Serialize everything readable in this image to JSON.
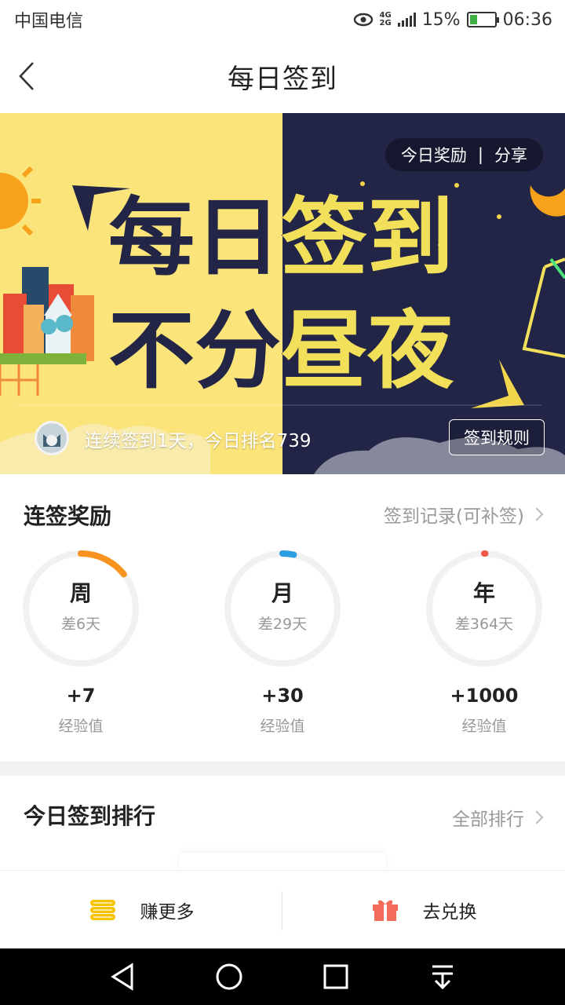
{
  "status_bar": {
    "carrier": "中国电信",
    "network": "4G",
    "network2": "2G",
    "battery": "15%",
    "time": "06:36"
  },
  "header": {
    "title": "每日签到"
  },
  "banner": {
    "headline_line1": "每日签到",
    "headline_line2": "不分昼夜",
    "today_reward": "今日奖励",
    "separator": "|",
    "share": "分享",
    "streak_text": "连续签到1天，今日排名739",
    "rules_button": "签到规则"
  },
  "streak_rewards": {
    "title": "连签奖励",
    "record_link": "签到记录(可补签)",
    "items": [
      {
        "label": "周",
        "remaining": "差6天",
        "exp": "+7",
        "exp_label": "经验值",
        "progress": 0.143,
        "color": "#f7931e"
      },
      {
        "label": "月",
        "remaining": "差29天",
        "exp": "+30",
        "exp_label": "经验值",
        "progress": 0.033,
        "color": "#2b9ee3"
      },
      {
        "label": "年",
        "remaining": "差364天",
        "exp": "+1000",
        "exp_label": "经验值",
        "progress": 0.003,
        "color": "#f0584a"
      }
    ]
  },
  "ranking": {
    "title": "今日签到排行",
    "all_link": "全部排行"
  },
  "actions": {
    "earn_more": "赚更多",
    "redeem": "去兑换"
  },
  "colors": {
    "accent_orange": "#f7931e",
    "coin_yellow": "#f9c300",
    "gift_red": "#f26b5b",
    "banner_day": "#fbe47a",
    "banner_night": "#222545"
  }
}
